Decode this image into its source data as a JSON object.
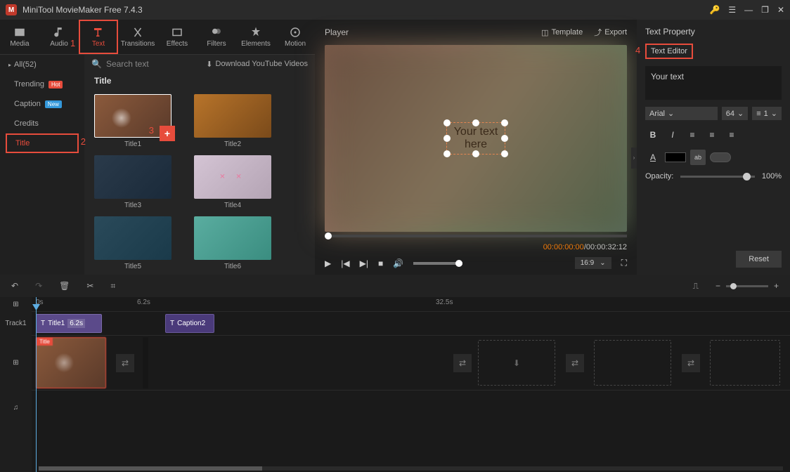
{
  "app": {
    "title": "MiniTool MovieMaker Free 7.4.3"
  },
  "toolbar": {
    "media": "Media",
    "audio": "Audio",
    "text": "Text",
    "transitions": "Transitions",
    "effects": "Effects",
    "filters": "Filters",
    "elements": "Elements",
    "motion": "Motion"
  },
  "sidebar": {
    "header": "All(52)",
    "items": [
      {
        "label": "Trending",
        "badge": "Hot"
      },
      {
        "label": "Caption",
        "badge": "New"
      },
      {
        "label": "Credits"
      },
      {
        "label": "Title"
      }
    ]
  },
  "content": {
    "search_placeholder": "Search text",
    "download_label": "Download YouTube Videos",
    "category": "Title",
    "thumbs": [
      "Title1",
      "Title2",
      "Title3",
      "Title4",
      "Title5",
      "Title6"
    ]
  },
  "player": {
    "label": "Player",
    "template": "Template",
    "export": "Export",
    "overlay_line1": "Your text",
    "overlay_line2": "here",
    "time_current": "00:00:00:00",
    "time_sep": " / ",
    "time_duration": "00:00:32:12",
    "ratio": "16:9"
  },
  "props": {
    "title": "Text Property",
    "tab": "Text Editor",
    "text_value": "Your text",
    "font": "Arial",
    "size": "64",
    "line": "1",
    "opacity_label": "Opacity:",
    "opacity_value": "100%",
    "reset": "Reset"
  },
  "timeline": {
    "marks": {
      "m0": "0s",
      "m1": "6.2s",
      "m2": "32.5s"
    },
    "track1_label": "Track1",
    "clip_title_label": "Title1",
    "clip_title_dur": "6.2s",
    "clip_caption_label": "Caption2",
    "title_tag": "Title"
  },
  "annotations": {
    "n1": "1",
    "n2": "2",
    "n3": "3",
    "n4": "4"
  }
}
